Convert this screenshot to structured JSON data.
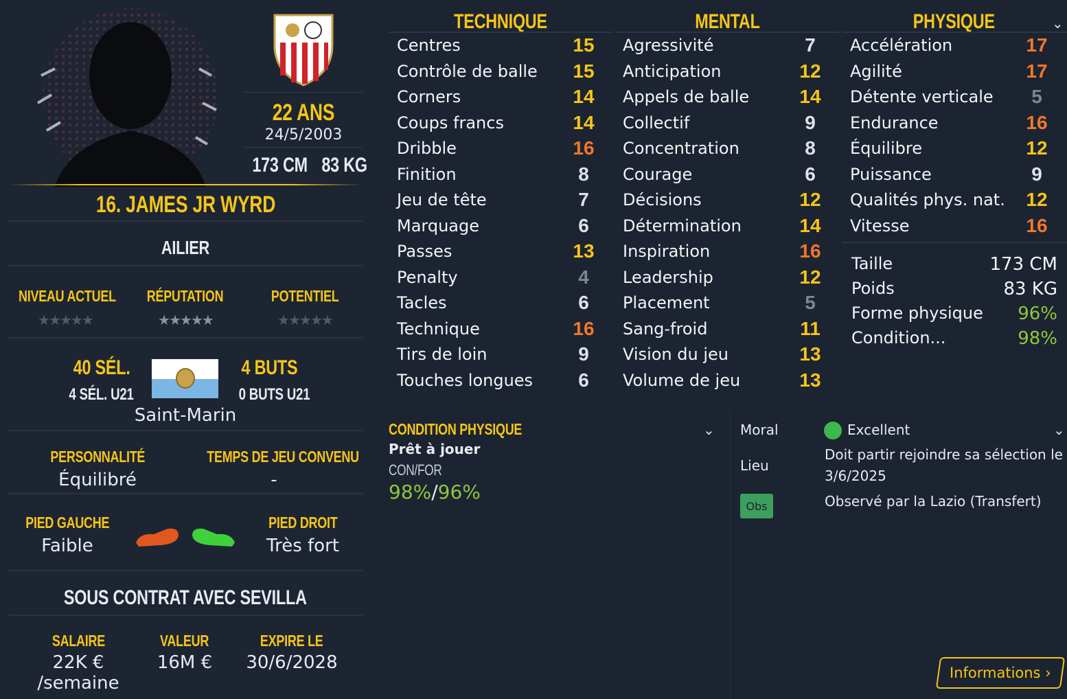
{
  "player": {
    "age": "22 ANS",
    "dob": "24/5/2003",
    "height": "173 CM",
    "weight": "83 KG",
    "name": "16. JAMES JR WYRD",
    "position": "AILIER"
  },
  "ratings": {
    "current_label": "NIVEAU ACTUEL",
    "reputation_label": "RÉPUTATION",
    "potential_label": "POTENTIEL",
    "stars": "★★★★★"
  },
  "international": {
    "caps": "40 SÉL.",
    "caps_u21": "4 SÉL. U21",
    "goals": "4 BUTS",
    "goals_u21": "0 BUTS U21",
    "country": "Saint-Marin"
  },
  "personality": {
    "label": "PERSONNALITÉ",
    "value": "Équilibré",
    "playtime_label": "TEMPS DE JEU CONVENU",
    "playtime_value": "-"
  },
  "feet": {
    "left_label": "PIED GAUCHE",
    "left_value": "Faible",
    "right_label": "PIED DROIT",
    "right_value": "Très fort"
  },
  "contract": {
    "title": "SOUS CONTRAT AVEC SEVILLA",
    "salary_label": "SALAIRE",
    "salary": "22K € /semaine",
    "value_label": "VALEUR",
    "value": "16M €",
    "expires_label": "EXPIRE LE",
    "expires": "30/6/2028"
  },
  "attributes": {
    "technique_title": "TECHNIQUE",
    "mental_title": "MENTAL",
    "physique_title": "PHYSIQUE",
    "technique": [
      {
        "name": "Centres",
        "value": "15",
        "tone": "y"
      },
      {
        "name": "Contrôle de balle",
        "value": "15",
        "tone": "y"
      },
      {
        "name": "Corners",
        "value": "14",
        "tone": "y"
      },
      {
        "name": "Coups francs",
        "value": "14",
        "tone": "y"
      },
      {
        "name": "Dribble",
        "value": "16",
        "tone": "o"
      },
      {
        "name": "Finition",
        "value": "8",
        "tone": "w"
      },
      {
        "name": "Jeu de tête",
        "value": "7",
        "tone": "w"
      },
      {
        "name": "Marquage",
        "value": "6",
        "tone": "w"
      },
      {
        "name": "Passes",
        "value": "13",
        "tone": "y"
      },
      {
        "name": "Penalty",
        "value": "4",
        "tone": "g"
      },
      {
        "name": "Tacles",
        "value": "6",
        "tone": "w"
      },
      {
        "name": "Technique",
        "value": "16",
        "tone": "o"
      },
      {
        "name": "Tirs de loin",
        "value": "9",
        "tone": "w"
      },
      {
        "name": "Touches longues",
        "value": "6",
        "tone": "w"
      }
    ],
    "mental": [
      {
        "name": "Agressivité",
        "value": "7",
        "tone": "w"
      },
      {
        "name": "Anticipation",
        "value": "12",
        "tone": "y"
      },
      {
        "name": "Appels de balle",
        "value": "14",
        "tone": "y"
      },
      {
        "name": "Collectif",
        "value": "9",
        "tone": "w"
      },
      {
        "name": "Concentration",
        "value": "8",
        "tone": "w"
      },
      {
        "name": "Courage",
        "value": "6",
        "tone": "w"
      },
      {
        "name": "Décisions",
        "value": "12",
        "tone": "y"
      },
      {
        "name": "Détermination",
        "value": "14",
        "tone": "y"
      },
      {
        "name": "Inspiration",
        "value": "16",
        "tone": "o"
      },
      {
        "name": "Leadership",
        "value": "12",
        "tone": "y"
      },
      {
        "name": "Placement",
        "value": "5",
        "tone": "g"
      },
      {
        "name": "Sang-froid",
        "value": "11",
        "tone": "y"
      },
      {
        "name": "Vision du jeu",
        "value": "13",
        "tone": "y"
      },
      {
        "name": "Volume de jeu",
        "value": "13",
        "tone": "y"
      }
    ],
    "physique": [
      {
        "name": "Accélération",
        "value": "17",
        "tone": "o"
      },
      {
        "name": "Agilité",
        "value": "17",
        "tone": "o"
      },
      {
        "name": "Détente verticale",
        "value": "5",
        "tone": "g"
      },
      {
        "name": "Endurance",
        "value": "16",
        "tone": "o"
      },
      {
        "name": "Équilibre",
        "value": "12",
        "tone": "y"
      },
      {
        "name": "Puissance",
        "value": "9",
        "tone": "w"
      },
      {
        "name": "Qualités phys. nat.",
        "value": "12",
        "tone": "y"
      },
      {
        "name": "Vitesse",
        "value": "16",
        "tone": "o"
      }
    ]
  },
  "physical_info": {
    "height_label": "Taille",
    "height": "173 CM",
    "weight_label": "Poids",
    "weight": "83 KG",
    "fitness_label": "Forme physique",
    "fitness": "96%",
    "condition_label": "Condition...",
    "condition": "98%"
  },
  "condition": {
    "title": "CONDITION PHYSIQUE",
    "status": "Prêt à jouer",
    "confor_label": "CON/FOR",
    "con": "98%",
    "slash": "/",
    "for": "96%"
  },
  "morale": {
    "moral_label": "Moral",
    "moral_value": "Excellent",
    "place_label": "Lieu",
    "place_line1": "Doit partir rejoindre sa sélection le",
    "place_line2": "3/6/2025",
    "scouted": "Observé par la Lazio (Transfert)",
    "obs_label": "Obs"
  },
  "info_button": "Informations",
  "colors": {
    "accent": "#f5c518",
    "orange": "#f0772d",
    "green": "#8fc63d",
    "bg": "#1c2431"
  }
}
